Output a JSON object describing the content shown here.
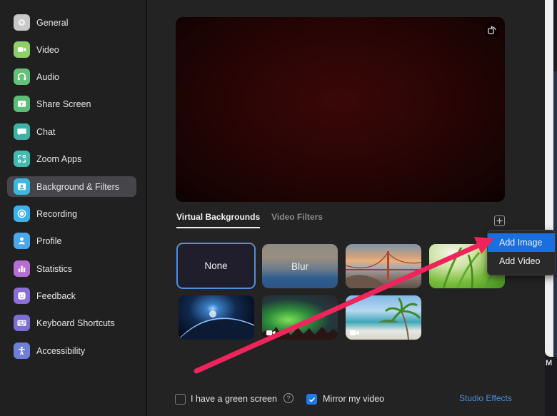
{
  "sidebar": {
    "items": [
      {
        "label": "General",
        "icon": "gear-icon",
        "color": "#c8c8c8"
      },
      {
        "label": "Video",
        "icon": "video-camera-icon",
        "color": "#8fcf6a"
      },
      {
        "label": "Audio",
        "icon": "headphones-icon",
        "color": "#66c07a"
      },
      {
        "label": "Share Screen",
        "icon": "share-screen-icon",
        "color": "#5bbd78"
      },
      {
        "label": "Chat",
        "icon": "chat-bubble-icon",
        "color": "#3cb3a6"
      },
      {
        "label": "Zoom Apps",
        "icon": "apps-icon",
        "color": "#43b9b0"
      },
      {
        "label": "Background & Filters",
        "icon": "background-person-icon",
        "color": "#3bb7e0",
        "active": true
      },
      {
        "label": "Recording",
        "icon": "record-icon",
        "color": "#3fb1ea"
      },
      {
        "label": "Profile",
        "icon": "profile-icon",
        "color": "#4aa9ec"
      },
      {
        "label": "Statistics",
        "icon": "bar-chart-icon",
        "color": "#b46fd0"
      },
      {
        "label": "Feedback",
        "icon": "smiley-icon",
        "color": "#8b6ed6"
      },
      {
        "label": "Keyboard Shortcuts",
        "icon": "keyboard-icon",
        "color": "#7b6fd6"
      },
      {
        "label": "Accessibility",
        "icon": "accessibility-icon",
        "color": "#6f7fd8"
      }
    ]
  },
  "preview": {
    "rotate_icon": "rotate-camera-icon"
  },
  "tabs": [
    {
      "label": "Virtual Backgrounds",
      "active": true
    },
    {
      "label": "Video Filters",
      "active": false
    }
  ],
  "add_button_icon": "plus-icon",
  "backgrounds": [
    {
      "label": "None",
      "type": "none",
      "selected": true
    },
    {
      "label": "Blur",
      "type": "blur"
    },
    {
      "label": "",
      "type": "image",
      "name": "golden-gate-bridge"
    },
    {
      "label": "",
      "type": "image",
      "name": "grass"
    },
    {
      "label": "",
      "type": "image",
      "name": "earth-from-space"
    },
    {
      "label": "",
      "type": "video",
      "name": "aurora"
    },
    {
      "label": "",
      "type": "video",
      "name": "beach"
    }
  ],
  "add_menu": {
    "items": [
      "Add Image",
      "Add Video"
    ],
    "highlighted": "Add Image"
  },
  "footer": {
    "green_screen": {
      "label": "I have a green screen",
      "checked": false
    },
    "help_icon": "?",
    "mirror": {
      "label": "Mirror my video",
      "checked": true
    },
    "studio_effects": "Studio Effects"
  },
  "background_window": {
    "letter": "M"
  },
  "annotation": {
    "arrow_color": "#f0245c"
  }
}
